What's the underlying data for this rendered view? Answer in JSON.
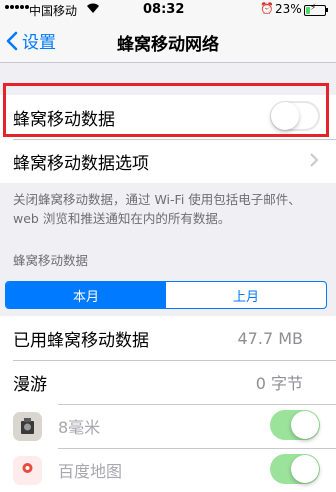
{
  "status_bar": {
    "carrier": "中国移动",
    "time": "08:32",
    "battery_percent": "23%",
    "battery_level": 0.23
  },
  "nav": {
    "back_label": "设置",
    "title": "蜂窝移动网络"
  },
  "cellular_data": {
    "label": "蜂窝移动数据",
    "enabled": false
  },
  "cellular_options": {
    "label": "蜂窝移动数据选项"
  },
  "footer_note": "关闭蜂窝移动数据，通过 Wi-Fi 使用包括电子邮件、web 浏览和推送通知在内的所有数据。",
  "usage_section": {
    "header": "蜂窝移动数据",
    "segments": [
      "本月",
      "上月"
    ],
    "selected_segment": 0
  },
  "usage_rows": [
    {
      "label": "已用蜂窝移动数据",
      "value": "47.7 MB"
    },
    {
      "label": "漫游",
      "value": "0 字节"
    }
  ],
  "apps": [
    {
      "name": "8毫米",
      "icon": "camera-app-icon",
      "enabled": true
    },
    {
      "name": "百度地图",
      "icon": "map-app-icon",
      "enabled": true
    }
  ],
  "colors": {
    "accent": "#007aff",
    "highlight": "#e3242b",
    "toggle_on": "#9be29b"
  }
}
